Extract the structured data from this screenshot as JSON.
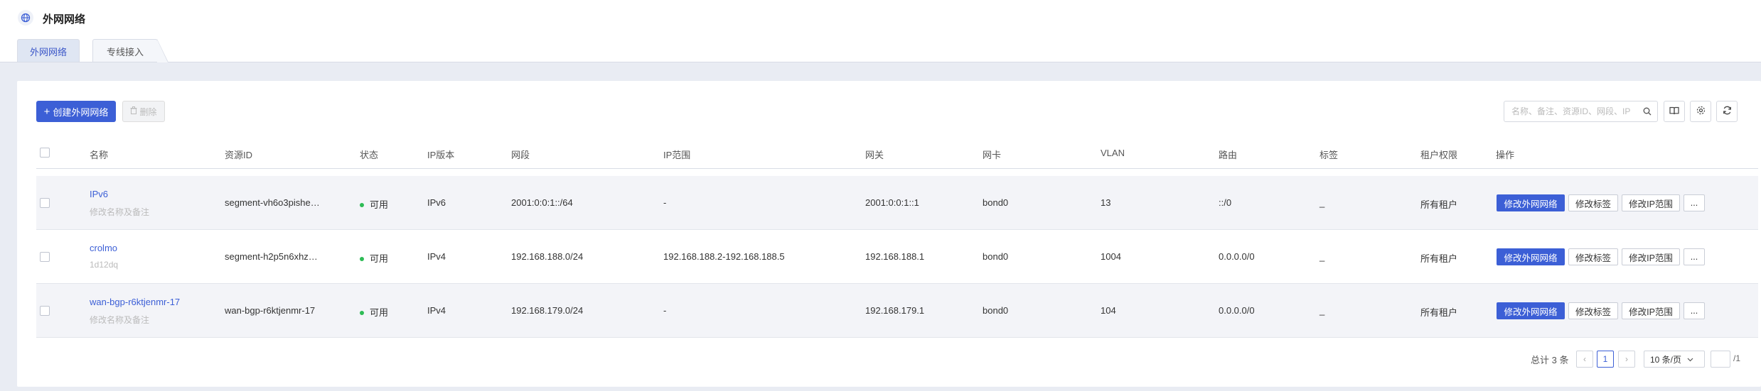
{
  "header": {
    "title": "外网网络",
    "icon": "globe-icon"
  },
  "tabs": [
    {
      "label": "外网网络",
      "active": true
    },
    {
      "label": "专线接入",
      "active": false
    }
  ],
  "toolbar": {
    "create_label": "创建外网网络",
    "delete_label": "删除",
    "search_placeholder": "名称、备注、资源ID、网段、IP"
  },
  "columns": [
    "名称",
    "资源ID",
    "状态",
    "IP版本",
    "网段",
    "IP范围",
    "网关",
    "网卡",
    "VLAN",
    "路由",
    "标签",
    "租户权限",
    "操作"
  ],
  "rows": [
    {
      "name": "IPv6",
      "remark": "修改名称及备注",
      "resource_id": "segment-vh6o3pishe…",
      "status": "可用",
      "ip_version": "IPv6",
      "segment": "2001:0:0:1::/64",
      "ip_range": "-",
      "gateway": "2001:0:0:1::1",
      "nic": "bond0",
      "vlan": "13",
      "route": "::/0",
      "tag": "_",
      "tenant": "所有租户"
    },
    {
      "name": "crolmo",
      "remark": "1d12dq",
      "resource_id": "segment-h2p5n6xhz…",
      "status": "可用",
      "ip_version": "IPv4",
      "segment": "192.168.188.0/24",
      "ip_range": "192.168.188.2-192.168.188.5",
      "gateway": "192.168.188.1",
      "nic": "bond0",
      "vlan": "1004",
      "route": "0.0.0.0/0",
      "tag": "_",
      "tenant": "所有租户"
    },
    {
      "name": "wan-bgp-r6ktjenmr-17",
      "remark": "修改名称及备注",
      "resource_id": "wan-bgp-r6ktjenmr-17",
      "status": "可用",
      "ip_version": "IPv4",
      "segment": "192.168.179.0/24",
      "ip_range": "-",
      "gateway": "192.168.179.1",
      "nic": "bond0",
      "vlan": "104",
      "route": "0.0.0.0/0",
      "tag": "_",
      "tenant": "所有租户"
    }
  ],
  "row_actions": {
    "modify_network": "修改外网网络",
    "modify_tags": "修改标签",
    "modify_ip_range": "修改IP范围",
    "more": "..."
  },
  "pagination": {
    "total_label": "总计 3 条",
    "current_page": "1",
    "page_size": "10 条/页",
    "total_pages": "/1"
  },
  "colors": {
    "primary": "#3c5fd6",
    "status_ok": "#2dbb55",
    "background": "#e9ecf3"
  }
}
